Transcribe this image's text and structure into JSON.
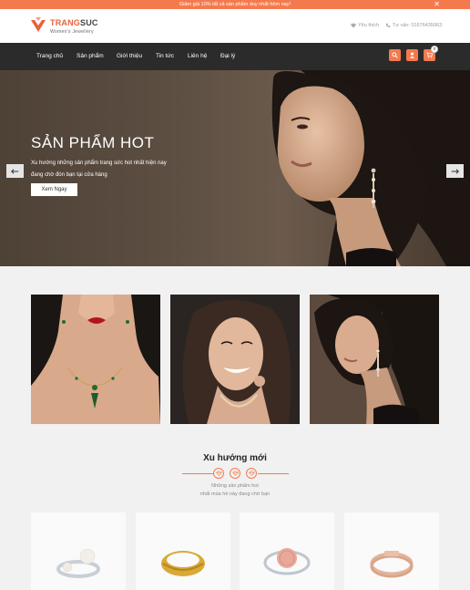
{
  "promo": {
    "text": "Giảm giá 10% tất cả sản phẩm duy nhất hôm nay!",
    "close": "✕"
  },
  "header": {
    "brand_main": "TRANG",
    "brand_accent": "SUC",
    "tagline": "Women's Jewellery",
    "wishlist": "Yêu thích",
    "hotline": "Tư vấn: 01676435063"
  },
  "nav": {
    "items": [
      "Trang chủ",
      "Sản phẩm",
      "Giới thiệu",
      "Tin tức",
      "Liên hệ",
      "Đại lý"
    ],
    "cart_count": "0",
    "icons": [
      "search-icon",
      "user-icon",
      "cart-icon"
    ]
  },
  "hero": {
    "title": "SẢN PHẨM HOT",
    "desc_line1": "Xu hướng những sản phẩm trang sức hot nhất hiện nay",
    "desc_line2": "đang chờ đón bạn tại cửa hàng",
    "button": "Xem Ngay"
  },
  "trend": {
    "title": "Xu hướng mới",
    "sub_line1": "Những sản phẩm hot",
    "sub_line2": "nhất mùa hè này đang chờ bạn"
  },
  "colors": {
    "accent": "#f47a4e",
    "nav_bg": "#2b2b2b",
    "page_bg": "#f1f1f1"
  }
}
